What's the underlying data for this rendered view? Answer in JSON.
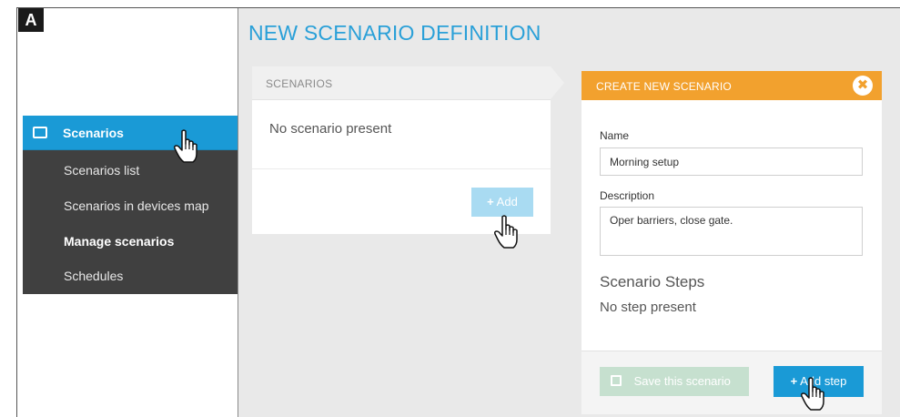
{
  "figure_label": "A",
  "sidebar": {
    "active_item": {
      "label": "Scenarios",
      "icon": "monitor-icon"
    },
    "items": [
      {
        "label": "Scenarios list",
        "bold": false
      },
      {
        "label": "Scenarios in devices map",
        "bold": false
      },
      {
        "label": "Manage scenarios",
        "bold": true
      },
      {
        "label": "Schedules",
        "bold": false
      }
    ]
  },
  "page": {
    "title": "NEW SCENARIO DEFINITION"
  },
  "scenarios_panel": {
    "header": "SCENARIOS",
    "empty_text": "No scenario present",
    "add_button": {
      "label": "Add",
      "icon": "plus-icon"
    }
  },
  "create_panel": {
    "header": "CREATE NEW SCENARIO",
    "close_icon": "close-icon",
    "name_label": "Name",
    "name_value": "Morning setup",
    "description_label": "Description",
    "description_value": "Oper barriers, close gate.",
    "steps_title": "Scenario Steps",
    "steps_empty": "No step present",
    "save_button": {
      "label": "Save this scenario",
      "icon": "save-icon"
    },
    "add_step_button": {
      "label": "Add step",
      "icon": "plus-icon"
    }
  },
  "colors": {
    "accent_blue": "#1a9ad6",
    "title_blue": "#2aa0d8",
    "header_orange": "#f2a12e",
    "sidebar_dark": "#404040",
    "disabled_blue": "#a9dbf2",
    "disabled_green": "#c6e0cf"
  }
}
